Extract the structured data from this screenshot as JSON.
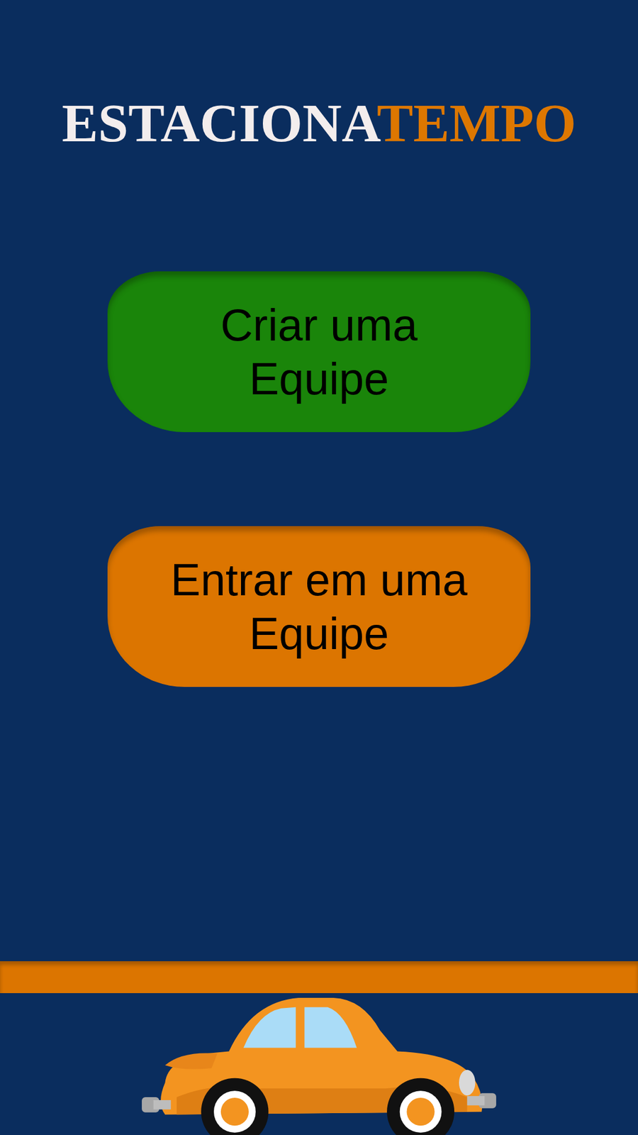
{
  "title": {
    "first": "ESTACIONA",
    "second": "TEMPO"
  },
  "buttons": [
    {
      "label": "Criar uma Equipe",
      "color": "#1a850a"
    },
    {
      "label": "Entrar em uma Equipe",
      "color": "#dc7500"
    }
  ]
}
